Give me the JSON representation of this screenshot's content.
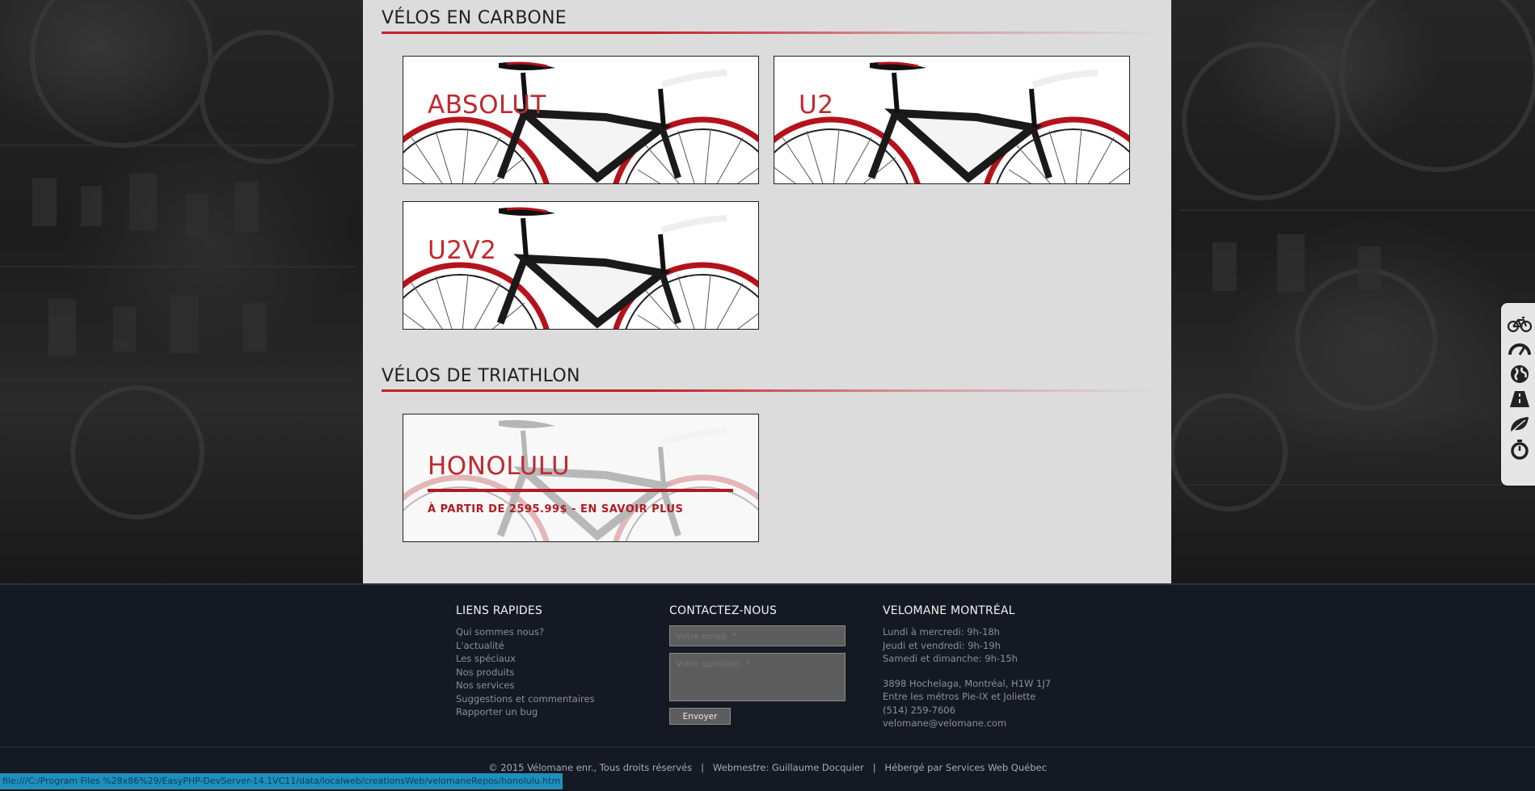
{
  "sections": [
    {
      "title": "VÉLOS EN CARBONE",
      "products": [
        {
          "name": "ABSOLUT"
        },
        {
          "name": "U2"
        },
        {
          "name": "U2V2"
        }
      ]
    },
    {
      "title": "VÉLOS DE TRIATHLON",
      "products": [
        {
          "name": "HONOLULU",
          "cta": "À PARTIR DE 2595.99$ - EN SAVOIR PLUS"
        }
      ]
    }
  ],
  "sidebar": {
    "icons": [
      "bicycle-icon",
      "speedometer-icon",
      "globe-icon",
      "road-icon",
      "leaf-icon",
      "stopwatch-icon"
    ]
  },
  "footer": {
    "quick_links": {
      "title": "LIENS RAPIDES",
      "items": [
        "Qui sommes nous?",
        "L'actualité",
        "Les spéciaux",
        "Nos produits",
        "Nos services",
        "Suggestions et commentaires",
        "Rapporter un bug"
      ]
    },
    "contact": {
      "title": "CONTACTEZ-NOUS",
      "email_placeholder": "Votre email  *",
      "question_placeholder": "Votre question  *",
      "submit_label": "Envoyer"
    },
    "store": {
      "title": "VELOMANE MONTRÉAL",
      "hours": [
        "Lundi à mercredi: 9h-18h",
        "Jeudi et vendredi: 9h-19h",
        "Samedi et dimanche: 9h-15h"
      ],
      "address": [
        "3898 Hochelaga, Montréal, H1W 1J7",
        "Entre les métros Pie-IX et Joliette",
        "(514) 259-7606",
        "velomane@velomane.com"
      ]
    },
    "copyright": "© 2015 Vélomane enr., Tous droits réservés   |   Webmestre: Guillaume Docquier   |   Hébergé par Services Web Québec"
  },
  "status_bar": {
    "url": "file:///C:/Program Files %28x86%29/EasyPHP-DevServer-14.1VC11/data/localweb/creationsWeb/velomaneRepos/honolulu.htm"
  },
  "colors": {
    "accent": "#c0292f",
    "content_bg": "#dcdcdc",
    "footer_bg": "#141923",
    "status_bar": "#1e8fbe"
  }
}
